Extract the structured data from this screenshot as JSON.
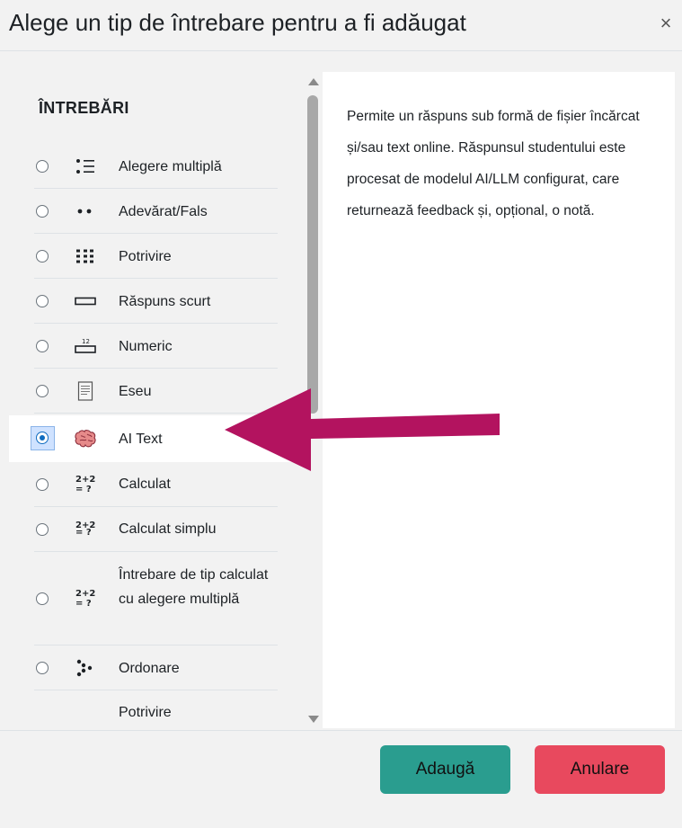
{
  "dialog": {
    "title": "Alege un tip de întrebare pentru a fi adăugat",
    "close_label": "×"
  },
  "list": {
    "section_title": "ÎNTREBĂRI",
    "items": [
      {
        "label": "Alegere multiplă",
        "icon": "multichoice-icon",
        "selected": false
      },
      {
        "label": "Adevărat/Fals",
        "icon": "truefalse-icon",
        "selected": false
      },
      {
        "label": "Potrivire",
        "icon": "match-icon",
        "selected": false
      },
      {
        "label": "Răspuns scurt",
        "icon": "shortanswer-icon",
        "selected": false
      },
      {
        "label": "Numeric",
        "icon": "numeric-icon",
        "selected": false
      },
      {
        "label": "Eseu",
        "icon": "essay-icon",
        "selected": false
      },
      {
        "label": "AI Text",
        "icon": "brain-icon",
        "selected": true
      },
      {
        "label": "Calculat",
        "icon": "calculated-icon",
        "selected": false
      },
      {
        "label": "Calculat simplu",
        "icon": "calculated-simple-icon",
        "selected": false
      },
      {
        "label": "Întrebare de tip calculat cu alegere multiplă",
        "icon": "calculated-multi-icon",
        "selected": false
      },
      {
        "label": "Ordonare",
        "icon": "ordering-icon",
        "selected": false
      },
      {
        "label": "Potrivire",
        "icon": "",
        "selected": false
      }
    ]
  },
  "description": {
    "text": "Permite un răspuns sub formă de fișier încărcat și/sau text online. Răspunsul studentului este procesat de modelul AI/LLM configurat, care returnează feedback și, opțional, o notă."
  },
  "footer": {
    "add_label": "Adaugă",
    "cancel_label": "Anulare"
  },
  "colors": {
    "add_button": "#2a9d8f",
    "cancel_button": "#e8495e",
    "annotation_arrow": "#b3135f",
    "radio_selected": "#0f6cbf"
  }
}
